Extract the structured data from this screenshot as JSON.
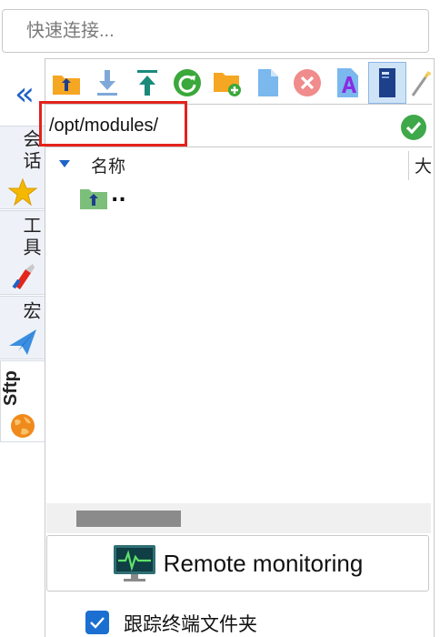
{
  "quick_connect": {
    "placeholder": "快速连接..."
  },
  "sidebar": {
    "collapse_icon": "double-chevron-left-icon",
    "tabs": [
      {
        "label": "会话",
        "icon": "star-icon"
      },
      {
        "label": "工具",
        "icon": "tools-icon"
      },
      {
        "label": "宏",
        "icon": "paper-plane-icon"
      },
      {
        "label": "Sftp",
        "icon": "globe-icon",
        "active": true
      }
    ]
  },
  "toolbar": {
    "buttons": [
      {
        "name": "parent-folder-icon"
      },
      {
        "name": "download-icon"
      },
      {
        "name": "upload-icon"
      },
      {
        "name": "refresh-icon"
      },
      {
        "name": "new-folder-icon"
      },
      {
        "name": "new-file-icon"
      },
      {
        "name": "delete-icon"
      },
      {
        "name": "rename-icon"
      },
      {
        "name": "text-editor-icon",
        "active": true
      },
      {
        "name": "magic-wand-icon"
      }
    ]
  },
  "path_bar": {
    "value": "/opt/modules/"
  },
  "file_list": {
    "columns": [
      "名称",
      "大"
    ],
    "rows": [
      {
        "name": "..",
        "icon": "parent-folder-icon"
      }
    ]
  },
  "remote_monitoring": {
    "label": "Remote monitoring"
  },
  "track_terminal": {
    "label": "跟踪终端文件夹",
    "checked": true
  },
  "colors": {
    "accent": "#1e62c6",
    "highlight": "#e3221c",
    "ok_green": "#3fa84a"
  }
}
